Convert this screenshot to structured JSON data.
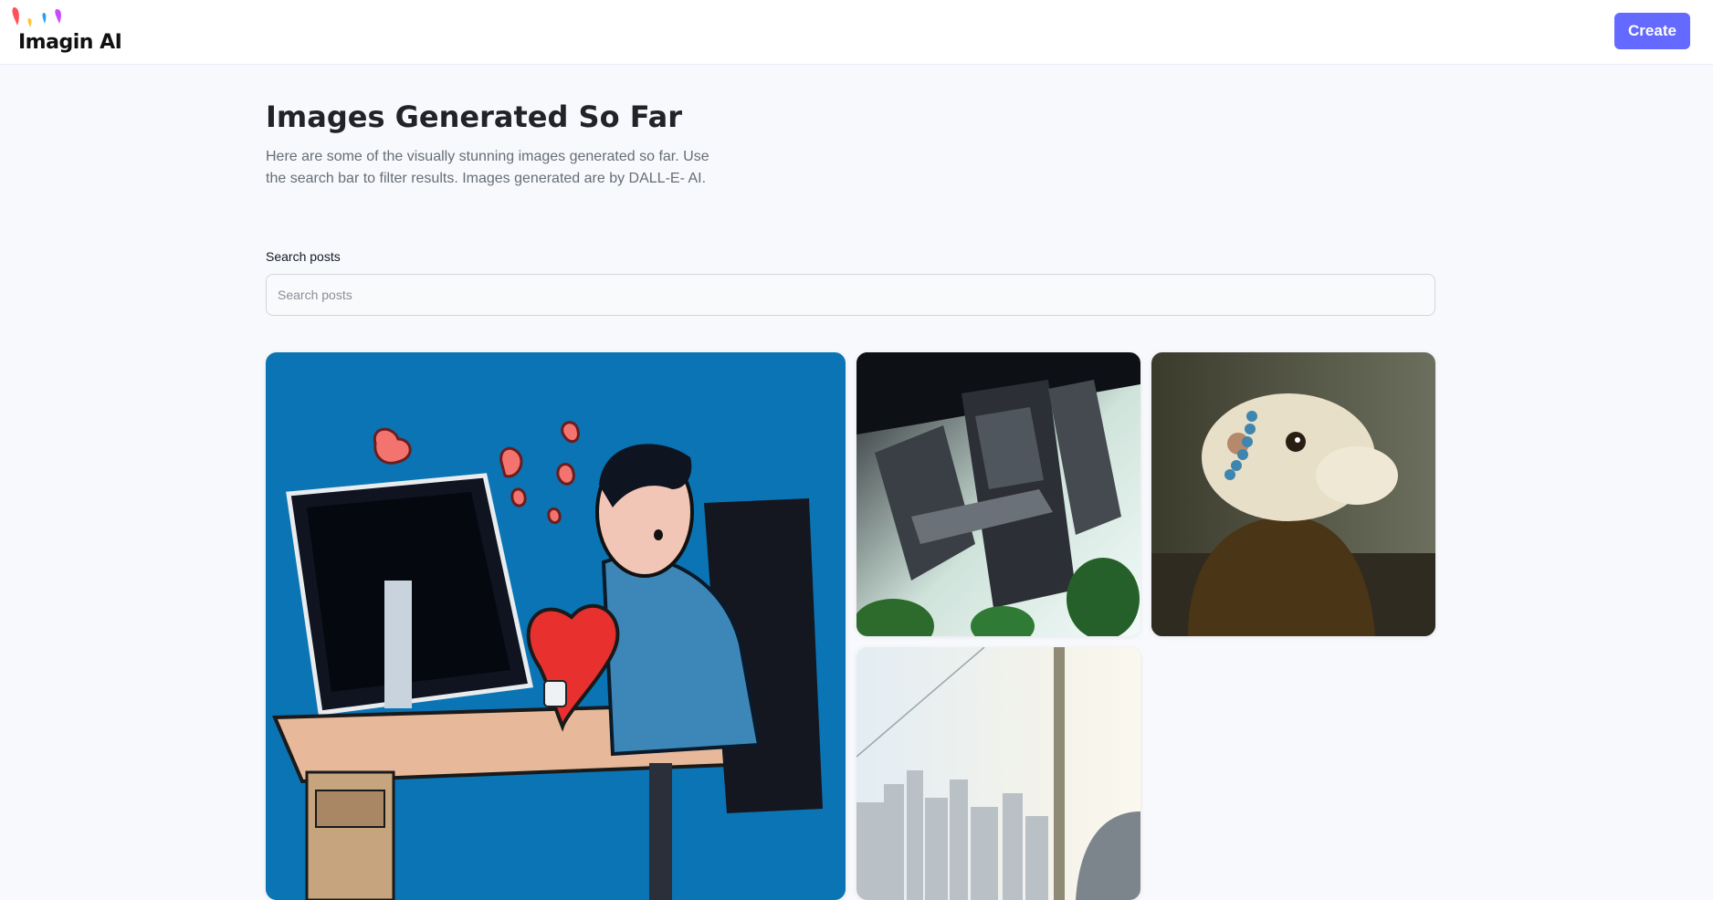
{
  "header": {
    "logo_text": "Imagin AI",
    "create_label": "Create"
  },
  "main": {
    "title": "Images Generated So Far",
    "subtitle": "Here are some of the visually stunning images generated so far. Use the search bar to filter results. Images generated are by DALL-E- AI.",
    "search": {
      "label": "Search posts",
      "placeholder": "Search posts",
      "value": ""
    }
  },
  "colors": {
    "accent": "#6469ff",
    "background": "#f8f9fd"
  }
}
